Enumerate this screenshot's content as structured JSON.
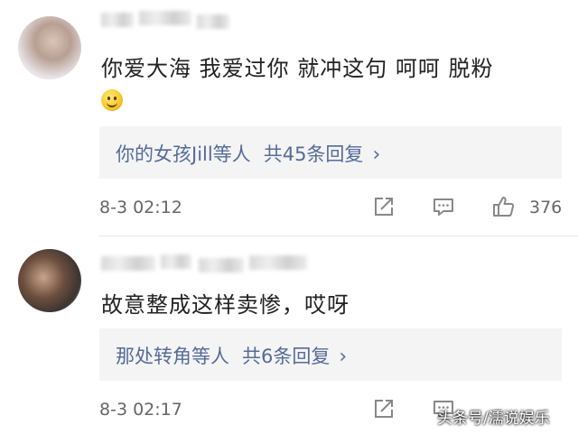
{
  "comments": [
    {
      "text": "你爱大海 我爱过你 就冲这句 呵呵 脱粉",
      "emoji": "smiley-emoji",
      "reply_summary": {
        "users": "你的女孩Jill等人",
        "count": "共45条回复",
        "chevron": "›"
      },
      "time": "8-3 02:12",
      "likes": "376"
    },
    {
      "text": "故意整成这样卖惨，哎呀",
      "reply_summary": {
        "users": "那处转角等人",
        "count": "共6条回复",
        "chevron": "›"
      },
      "time": "8-3 02:17",
      "likes": ""
    }
  ],
  "watermark": "头条号/濡说娱乐",
  "colors": {
    "link": "#556b99",
    "reply_bg": "#f4f4f4",
    "text": "#222222",
    "meta": "#666666"
  }
}
